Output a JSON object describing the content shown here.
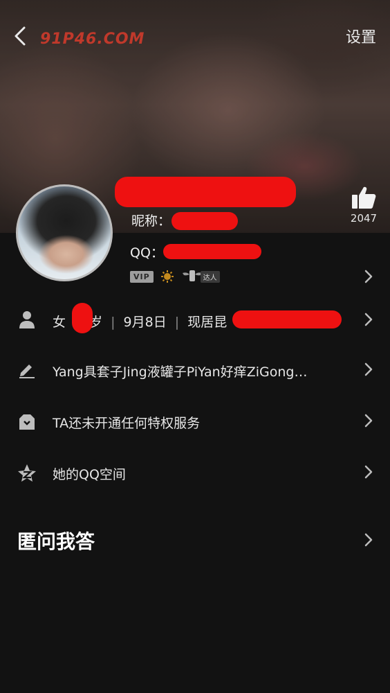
{
  "header": {
    "watermark": "91P46.COM",
    "settings_label": "设置"
  },
  "profile": {
    "nickname_prefix": "昵称：",
    "qq_prefix": "QQ：",
    "like_count": "2047",
    "vip_label": "VIP",
    "daren_label": "达人"
  },
  "info_rows": [
    {
      "icon": "person-icon",
      "text_gender": "女",
      "text_age_suffix": "岁",
      "text_birthday": "9月8日",
      "text_location_prefix": "现居昆"
    },
    {
      "icon": "pencil-icon",
      "text": "Yang具套子Jing液罐子PiYan好痒ZiGong…"
    },
    {
      "icon": "privilege-icon",
      "text": "TA还未开通任何特权服务"
    },
    {
      "icon": "qzone-star-icon",
      "text": "她的QQ空间"
    }
  ],
  "qa_section": {
    "title": "匿问我答"
  },
  "colors": {
    "redaction": "#ee1111",
    "background": "#121212"
  }
}
